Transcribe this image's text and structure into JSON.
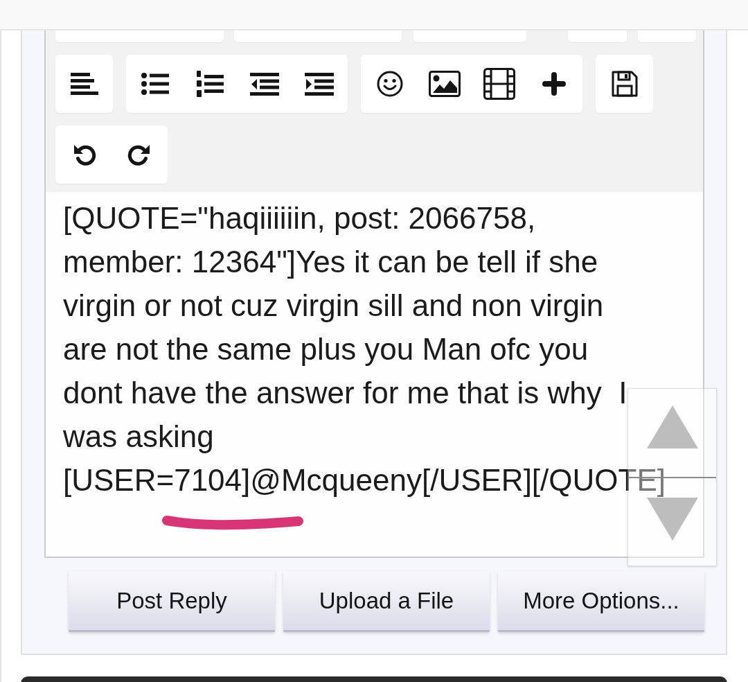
{
  "toolbar": {
    "groups": [
      {
        "buttons": [
          {
            "kind": "align"
          }
        ]
      },
      {
        "buttons": [
          {
            "kind": "bullets"
          },
          {
            "kind": "numbers"
          },
          {
            "kind": "outdent"
          },
          {
            "kind": "indent"
          }
        ]
      },
      {
        "buttons": [
          {
            "kind": "smilies"
          },
          {
            "kind": "image"
          },
          {
            "kind": "media"
          },
          {
            "kind": "insert"
          }
        ]
      },
      {
        "buttons": [
          {
            "kind": "save"
          }
        ]
      },
      {
        "buttons": [
          {
            "kind": "undo"
          },
          {
            "kind": "redo"
          }
        ]
      }
    ]
  },
  "editor": {
    "lines": [
      "[QUOTE=\"haqiiiiiin, post: 2066758,",
      "member: 12364\"]Yes it can be tell if she",
      "virgin or not cuz virgin sill and non virgin",
      "are not the same plus you Man ofc you",
      "dont have the answer for me that is why  I",
      "was asking",
      "[USER=7104]@Mcqueeny[/USER][/QUOTE]"
    ]
  },
  "buttons": [
    "Post Reply",
    "Upload a File",
    "More Options..."
  ]
}
